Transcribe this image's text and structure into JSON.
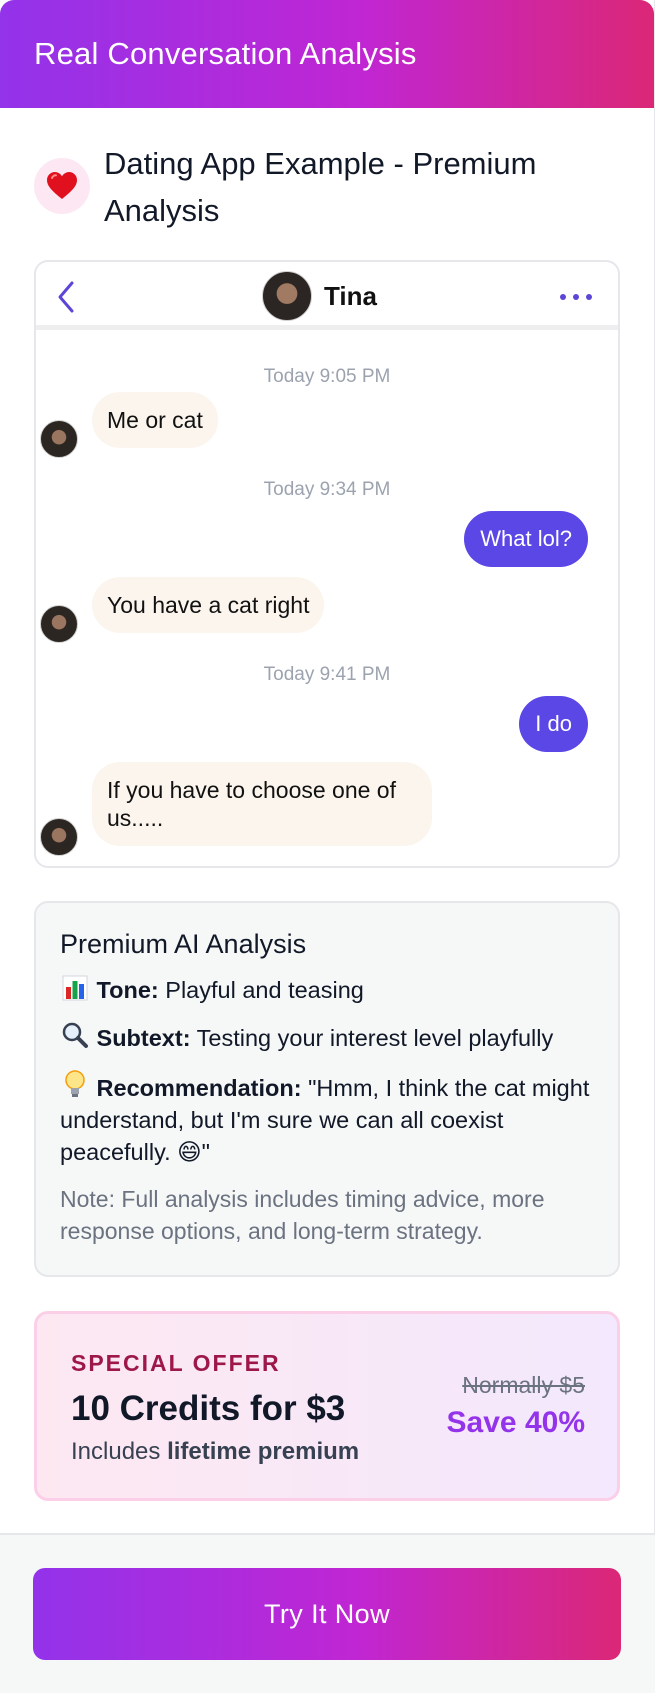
{
  "header": {
    "title": "Real Conversation Analysis"
  },
  "example": {
    "icon": "heart-icon",
    "title": "Dating App Example - Premium Analysis"
  },
  "chat": {
    "contact_name": "Tina",
    "messages": [
      {
        "type": "timestamp",
        "text": "Today 9:05 PM"
      },
      {
        "type": "incoming",
        "text": "Me or cat"
      },
      {
        "type": "timestamp",
        "text": "Today 9:34 PM"
      },
      {
        "type": "outgoing",
        "text": "What lol?"
      },
      {
        "type": "incoming",
        "text": "You have a cat right"
      },
      {
        "type": "timestamp",
        "text": "Today 9:41 PM"
      },
      {
        "type": "outgoing",
        "text": "I do"
      },
      {
        "type": "incoming",
        "text": "If you have to choose one of us....."
      }
    ]
  },
  "analysis": {
    "title": "Premium AI Analysis",
    "tone_label": "Tone:",
    "tone_value": "Playful and teasing",
    "tone_icon": "bar-chart-icon",
    "subtext_label": "Subtext:",
    "subtext_value": "Testing your interest level playfully",
    "subtext_icon": "magnifier-icon",
    "recommendation_label": "Recommendation:",
    "recommendation_value": "\"Hmm, I think the cat might understand, but I'm sure we can all coexist peacefully. 😄\"",
    "recommendation_icon": "lightbulb-icon",
    "note": "Note: Full analysis includes timing advice, more response options, and long-term strategy."
  },
  "offer": {
    "tag": "SPECIAL OFFER",
    "headline": "10 Credits for $3",
    "includes_prefix": "Includes ",
    "includes_bold": "lifetime premium",
    "normally": "Normally $5",
    "save": "Save 40%"
  },
  "cta": {
    "label": "Try It Now"
  },
  "colors": {
    "gradient_start": "#9333ea",
    "gradient_end": "#db2777",
    "outgoing_bubble": "#5b46e6",
    "incoming_bubble": "#fbf5ee",
    "offer_tag": "#9d1749",
    "save": "#9333ea"
  }
}
